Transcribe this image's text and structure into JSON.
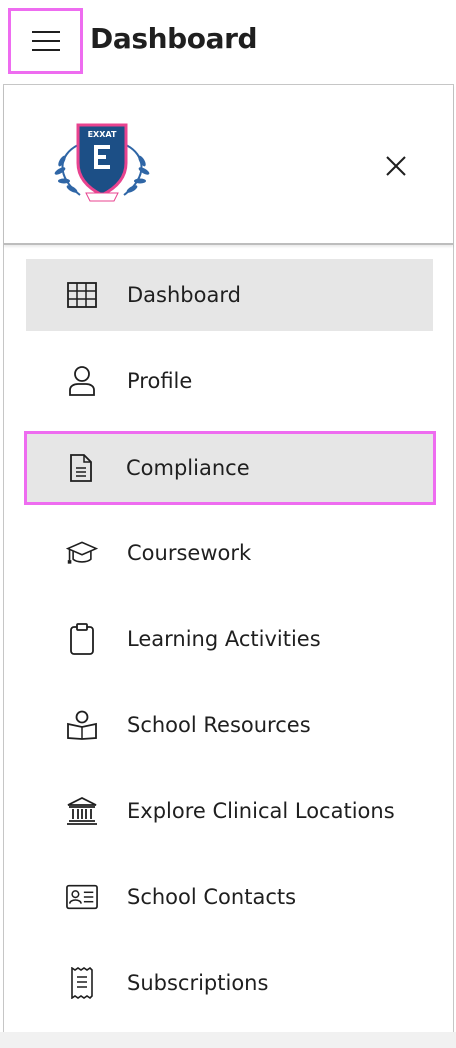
{
  "header": {
    "menu_icon": "hamburger-menu-icon",
    "title": "Dashboard"
  },
  "drawer": {
    "logo": {
      "icon": "school-crest-logo",
      "text": "EXXAT",
      "colors": {
        "shield": "#1c4f86",
        "border": "#e8438f",
        "laurel": "#2f66a6"
      }
    },
    "close_icon": "close-icon",
    "items": [
      {
        "label": "Dashboard",
        "icon": "grid-icon",
        "state": "active"
      },
      {
        "label": "Profile",
        "icon": "person-icon",
        "state": "normal"
      },
      {
        "label": "Compliance",
        "icon": "document-icon",
        "state": "highlighted"
      },
      {
        "label": "Coursework",
        "icon": "graduation-cap-icon",
        "state": "normal"
      },
      {
        "label": "Learning Activities",
        "icon": "clipboard-icon",
        "state": "normal"
      },
      {
        "label": "School Resources",
        "icon": "reading-person-icon",
        "state": "normal"
      },
      {
        "label": "Explore Clinical Locations",
        "icon": "institution-icon",
        "state": "normal"
      },
      {
        "label": "School Contacts",
        "icon": "contact-card-icon",
        "state": "normal"
      },
      {
        "label": "Subscriptions",
        "icon": "receipt-icon",
        "state": "normal"
      }
    ]
  },
  "colors": {
    "highlight_border": "#ee6cf0",
    "active_background": "#e6e6e6",
    "text": "#1f1f1f"
  }
}
